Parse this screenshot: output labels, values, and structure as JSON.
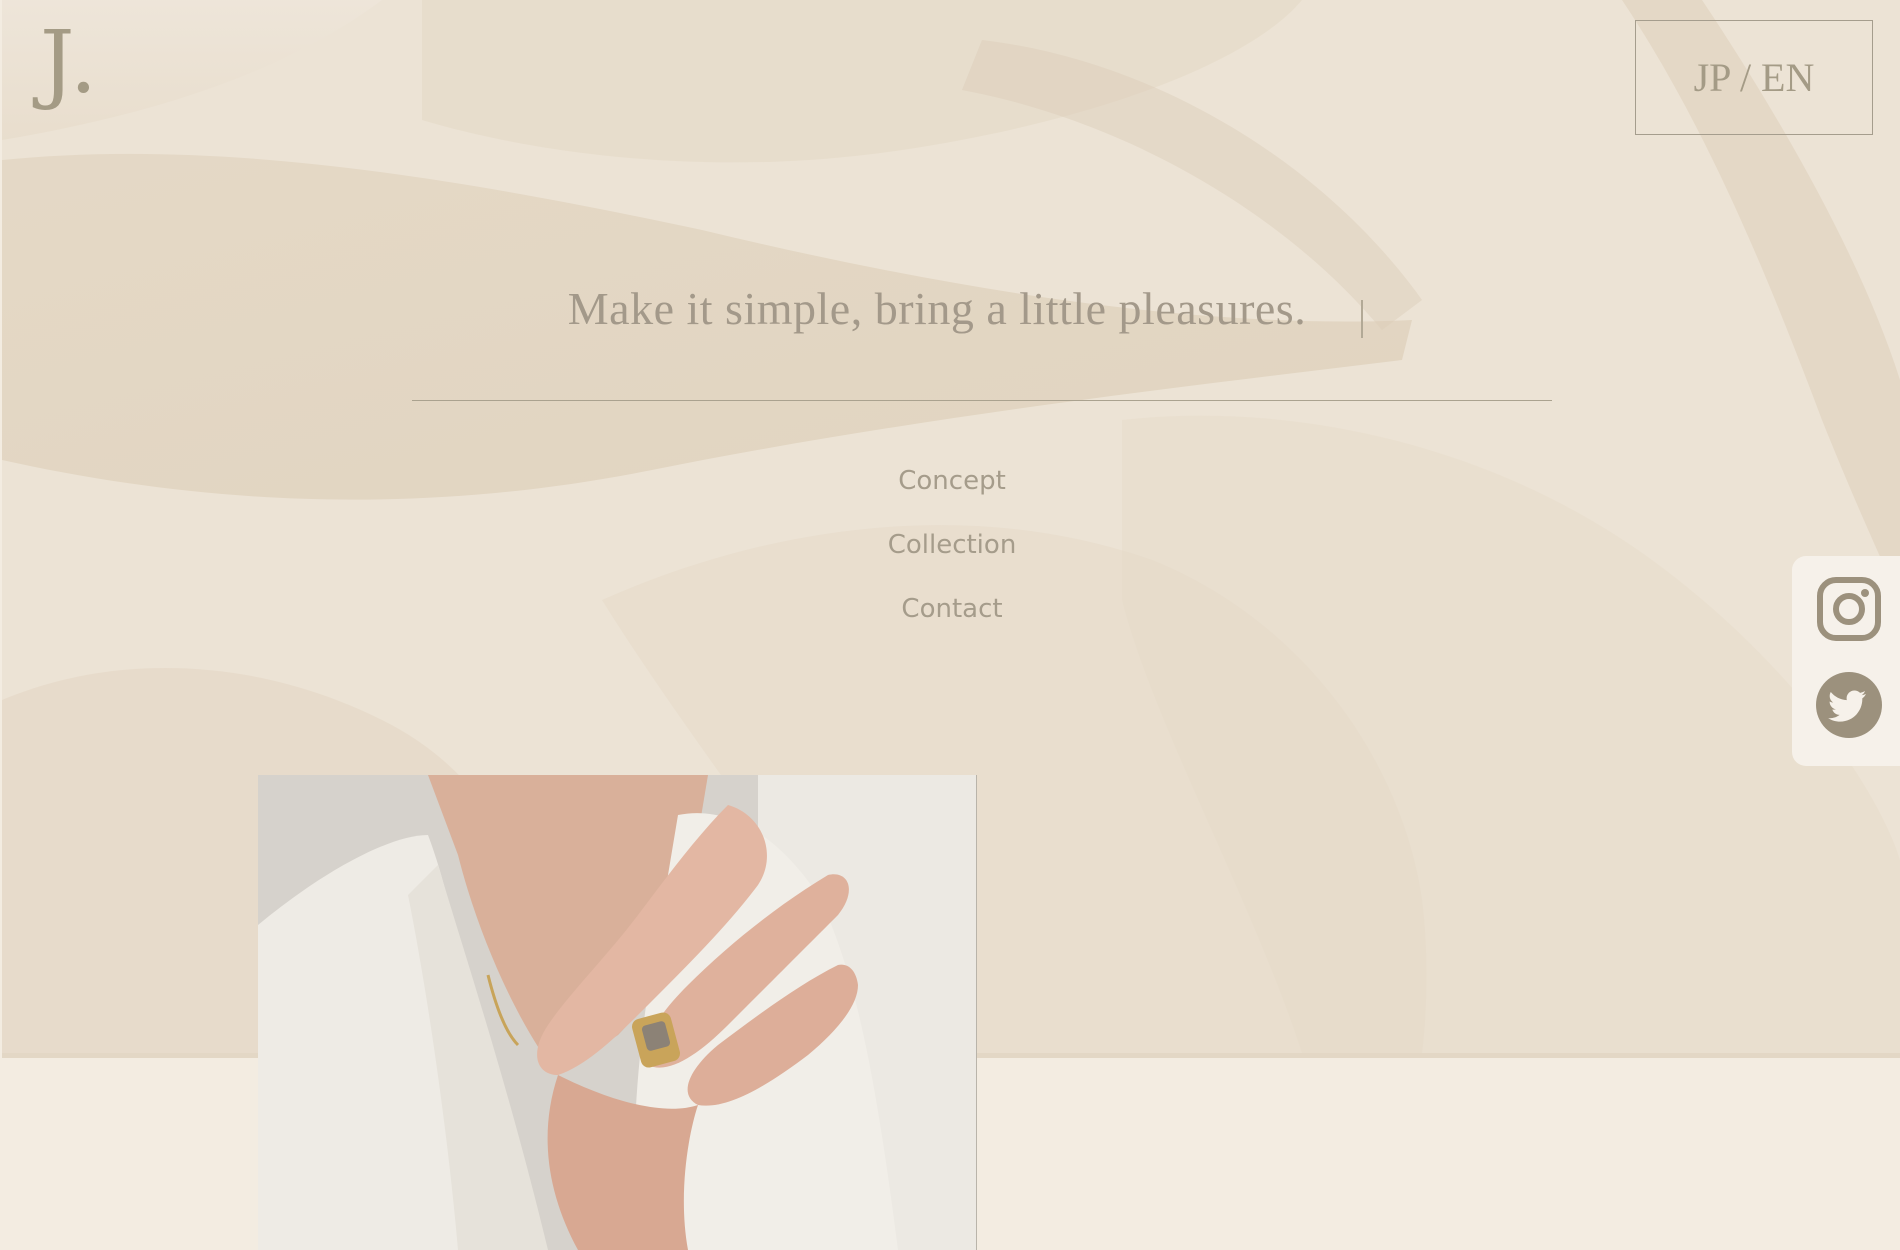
{
  "header": {
    "logo": "J.",
    "lang_toggle": "JP / EN"
  },
  "hero": {
    "tagline": "Make it simple, bring a little pleasures."
  },
  "nav": {
    "items": [
      {
        "label": "Concept"
      },
      {
        "label": "Collection"
      },
      {
        "label": "Contact"
      }
    ]
  },
  "social": {
    "icons": [
      "instagram-icon",
      "twitter-icon"
    ],
    "icon_color": "#9c917d"
  },
  "colors": {
    "hero_bg": "#ece2d3",
    "page_bg": "#f3ece1",
    "text": "#a3998a"
  }
}
